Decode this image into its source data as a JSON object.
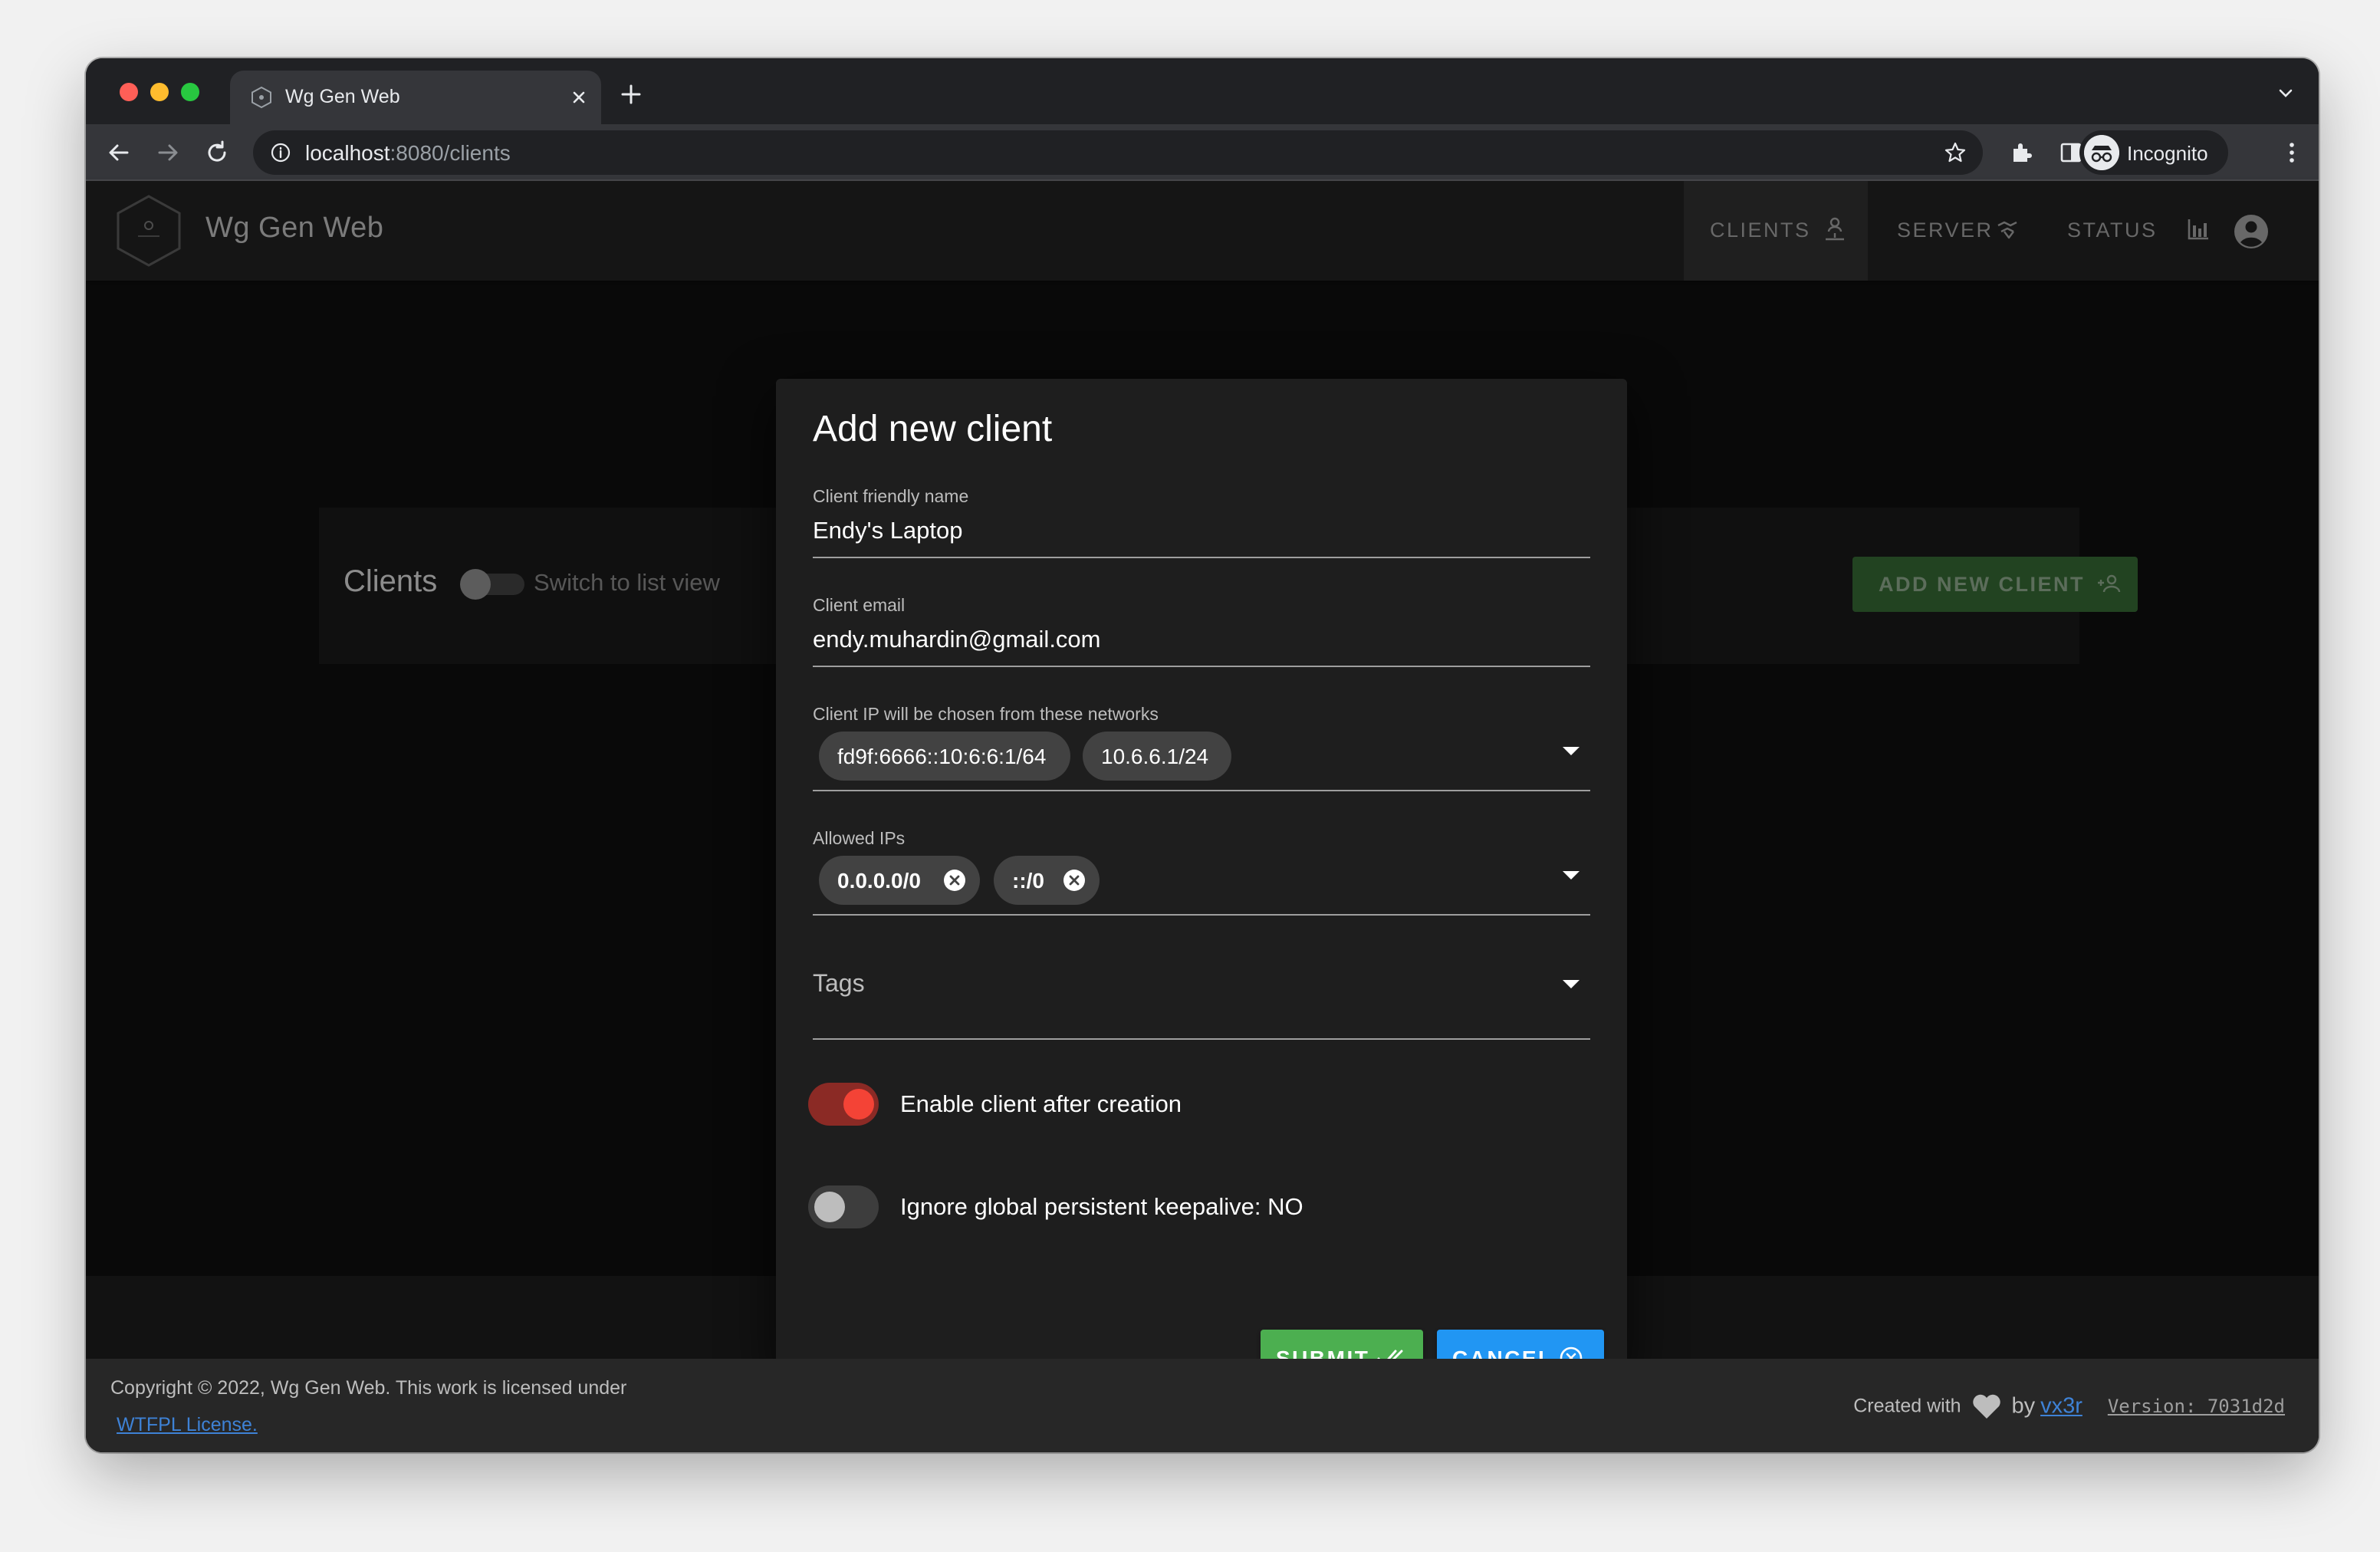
{
  "browser": {
    "tab_title": "Wg Gen Web",
    "url_host": "localhost",
    "url_rest": ":8080/clients",
    "profile_label": "Incognito"
  },
  "app": {
    "title": "Wg Gen Web",
    "nav": {
      "clients": "CLIENTS",
      "server": "SERVER",
      "status": "STATUS"
    }
  },
  "page": {
    "title": "Clients",
    "list_view_toggle_label": "Switch to list view",
    "add_button": "ADD NEW CLIENT"
  },
  "dialog": {
    "title": "Add new client",
    "name_label": "Client friendly name",
    "name_value": "Endy's Laptop",
    "email_label": "Client email",
    "email_value": "endy.muhardin@gmail.com",
    "networks_label": "Client IP will be chosen from these networks",
    "networks": [
      "fd9f:6666::10:6:6:1/64",
      "10.6.6.1/24"
    ],
    "allowed_ips_label": "Allowed IPs",
    "allowed_ips": [
      "0.0.0.0/0",
      "::/0"
    ],
    "tags_label": "Tags",
    "enable_label": "Enable client after creation",
    "enable_value": true,
    "keepalive_label": "Ignore global persistent keepalive: NO",
    "keepalive_value": false,
    "submit": "SUBMIT",
    "cancel": "CANCEL"
  },
  "footer": {
    "copyright": "Copyright © 2022, Wg Gen Web. This work is licensed under",
    "license_link": "WTFPL License.",
    "created_with": "Created with",
    "by": "by",
    "author": "vx3r",
    "version": "Version: 7031d2d"
  },
  "colors": {
    "submit": "#4caf50",
    "cancel": "#2196f3",
    "switch_on": "#f44336",
    "add_button": "#3f7a3d"
  }
}
